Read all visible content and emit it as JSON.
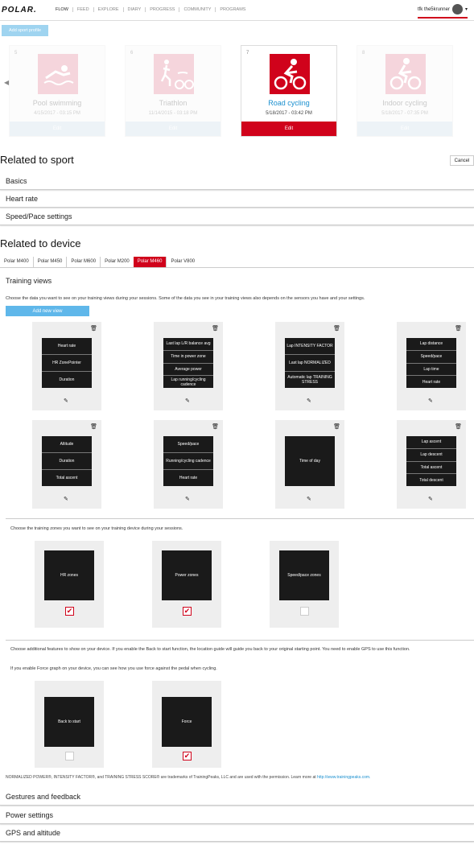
{
  "nav": {
    "logo": "POLAR.",
    "links": [
      "FLOW",
      "FEED",
      "EXPLORE",
      "DIARY",
      "PROGRESS",
      "COMMUNITY",
      "PROGRAMS"
    ],
    "username": "tfk the5krunner"
  },
  "add_profile_label": "Add sport profile",
  "sports": [
    {
      "num": "5",
      "name": "Pool swimming",
      "date": "4/15/2017 - 03:15 PM",
      "edit": "Edit",
      "icon": "swimming-icon"
    },
    {
      "num": "6",
      "name": "Triathlon",
      "date": "11/14/2015 - 03:18 PM",
      "edit": "Edit",
      "icon": "triathlon-icon"
    },
    {
      "num": "7",
      "name": "Road cycling",
      "date": "5/18/2017 - 03:42 PM",
      "edit": "Edit",
      "icon": "road-cycling-icon"
    },
    {
      "num": "8",
      "name": "Indoor cycling",
      "date": "5/18/2017 - 07:35 PM",
      "edit": "Edit",
      "icon": "indoor-cycling-icon"
    }
  ],
  "related_sport": {
    "title": "Related to sport",
    "cancel": "Cancel",
    "sections": [
      "Basics",
      "Heart rate",
      "Speed/Pace settings"
    ]
  },
  "related_device": {
    "title": "Related to device",
    "tabs": [
      "Polar M400",
      "Polar M450",
      "Polar M600",
      "Polar M200",
      "Polar M460",
      "Polar V800"
    ],
    "active_tab": "Polar M460"
  },
  "training_views": {
    "title": "Training views",
    "desc": "Choose the data you want to see on your training views during your sessions. Some of the data you see in your training views also depends on the sensors you have and your settings.",
    "add_label": "Add new view",
    "views": [
      [
        "Heart rate",
        "HR ZonePointer",
        "Duration"
      ],
      [
        "Last lap L/R balance avg",
        "Time in power zone",
        "Average power",
        "Lap running/cycling cadence"
      ],
      [
        "Lap INTENSITY FACTOR",
        "Last lap NORMALIZED",
        "Automatic lap TRAINING STRESS"
      ],
      [
        "Lap distance",
        "Speed/pace",
        "Lap time",
        "Heart rate"
      ],
      [
        "Altitude",
        "Duration",
        "Total ascent"
      ],
      [
        "Speed/pace",
        "Running/cycling cadence",
        "Heart rate"
      ],
      [
        "Time of day"
      ],
      [
        "Lap ascent",
        "Lap descent",
        "Total ascent",
        "Total descent"
      ]
    ]
  },
  "zones": {
    "desc": "Choose the training zones you want to see on your training device during your sessions.",
    "items": [
      {
        "label": "HR zones",
        "checked": true
      },
      {
        "label": "Power zones",
        "checked": true
      },
      {
        "label": "Speed/pace zones",
        "checked": false
      }
    ]
  },
  "features": {
    "desc1": "Choose additional features to show on your device. If you enable the Back to start function, the location guide will guide you back to your original starting point. You need to enable GPS to use this function.",
    "desc2": "If you enable Force graph on your device, you can see how you use force against the pedal when cycling.",
    "items": [
      {
        "label": "Back to start",
        "checked": false
      },
      {
        "label": "Force",
        "checked": true
      }
    ]
  },
  "trademark_note": "NORMALIZED POWER®, INTENSITY FACTOR®, and TRAINING STRESS SCORE® are trademarks of TrainingPeaks, LLC and are used with the permission. Learn more at",
  "trademark_link": "http://www.trainingpeaks.com.",
  "bottom_sections": [
    "Gestures and feedback",
    "Power settings",
    "GPS and altitude"
  ],
  "colors": {
    "accent": "#d0021b",
    "link": "#1a8fcf",
    "button": "#5fb7ea"
  }
}
